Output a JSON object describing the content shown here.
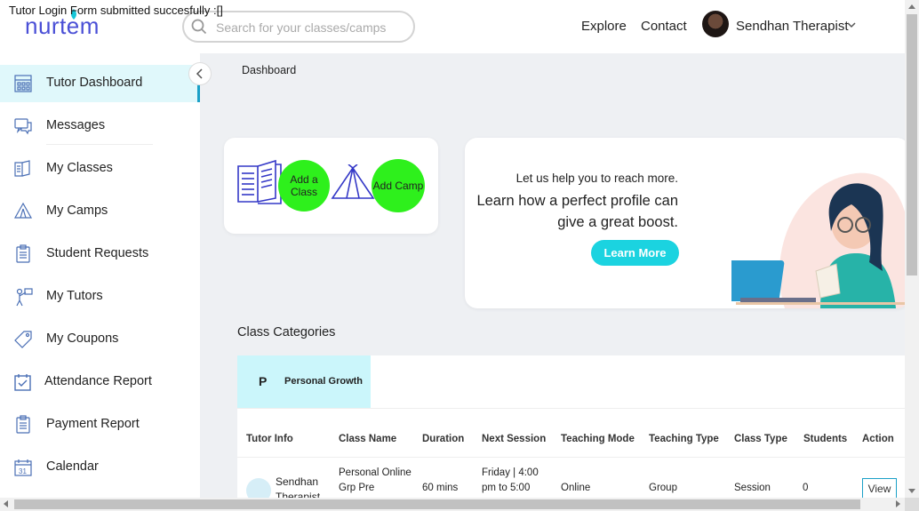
{
  "toast": "Tutor Login Form submitted succesfully :[]",
  "header": {
    "logo": "nurtem",
    "search_placeholder": "Search for your classes/camps",
    "nav": [
      "Explore",
      "Contact"
    ],
    "user_name": "Sendhan Therapist"
  },
  "sidebar": {
    "items": [
      {
        "label": "Tutor Dashboard",
        "icon": "dashboard-grid-icon",
        "active": true
      },
      {
        "label": "Messages",
        "icon": "chat-bubble-icon"
      },
      {
        "label": "My Classes",
        "icon": "book-icon"
      },
      {
        "label": "My Camps",
        "icon": "tent-icon"
      },
      {
        "label": "Student Requests",
        "icon": "clipboard-icon"
      },
      {
        "label": "My Tutors",
        "icon": "teacher-icon"
      },
      {
        "label": "My Coupons",
        "icon": "tag-icon"
      },
      {
        "label": "Attendance Report",
        "icon": "calendar-check-icon"
      },
      {
        "label": "Payment Report",
        "icon": "clipboard-icon"
      },
      {
        "label": "Calendar",
        "icon": "calendar-icon"
      }
    ]
  },
  "breadcrumb": "Dashboard",
  "actions": {
    "add_class": "Add a Class",
    "add_camp": "Add Camp"
  },
  "promo": {
    "small": "Let us help you to reach more.",
    "big": "Learn how a perfect profile can give a great boost.",
    "button": "Learn More"
  },
  "categories": {
    "title": "Class Categories",
    "tab_letter": "P",
    "tab_name": "Personal Growth",
    "columns": [
      "Tutor Info",
      "Class Name",
      "Duration",
      "Next Session",
      "Teaching Mode",
      "Teaching Type",
      "Class Type",
      "Students",
      "Action"
    ],
    "row": {
      "tutor": "Sendhan Therapist",
      "class_name": "Personal Online Grp Pre",
      "duration": "60 mins",
      "next_session": "Friday | 4:00 pm to 5:00",
      "mode": "Online",
      "type": "Group",
      "class_type": "Session",
      "students": "0",
      "action": "View"
    }
  },
  "colors": {
    "accent": "#1bd3e0",
    "active_bg": "#e0f8fb",
    "green": "#2ef01c",
    "logo": "#4a4fd6"
  }
}
